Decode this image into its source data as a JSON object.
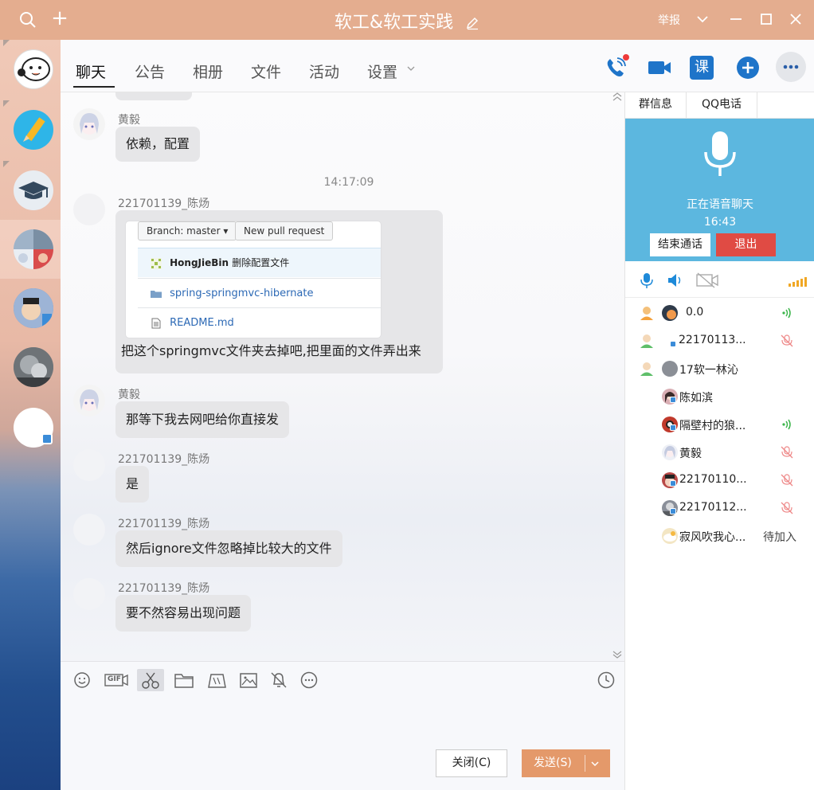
{
  "window": {
    "title": "软工&软工实践",
    "report_label": "举报"
  },
  "tabs": {
    "items": [
      {
        "label": "聊天"
      },
      {
        "label": "公告"
      },
      {
        "label": "相册"
      },
      {
        "label": "文件"
      },
      {
        "label": "活动"
      },
      {
        "label": "设置"
      }
    ],
    "active": "聊天",
    "icons": [
      "phone-call-icon",
      "video-call-icon",
      "class-icon",
      "add-icon",
      "more-icon"
    ],
    "class_label": "课"
  },
  "chat": {
    "messages": [
      {
        "sender": "黄毅",
        "text": "依赖，配置"
      },
      {
        "timestamp": "14:17:09"
      },
      {
        "sender": "221701139_陈炀",
        "text": "把这个springmvc文件夹去掉吧,把里面的文件弄出来",
        "attachment": {
          "branch_button": "Branch: master",
          "pull_request_button": "New pull request",
          "commit_author": "HongJieBin",
          "commit_message": "删除配置文件",
          "folder": "spring-springmvc-hibernate",
          "file": "README.md"
        }
      },
      {
        "sender": "黄毅",
        "text": "那等下我去网吧给你直接发"
      },
      {
        "sender": "221701139_陈炀",
        "text": "是"
      },
      {
        "sender": "221701139_陈炀",
        "text": "然后ignore文件忽略掉比较大的文件"
      },
      {
        "sender": "221701139_陈炀",
        "text": "要不然容易出现问题"
      }
    ]
  },
  "input": {
    "toolbar_icons": [
      "emoji-icon",
      "gif-icon",
      "screenshot-scissors-icon",
      "folder-icon",
      "gift-icon",
      "image-icon",
      "bell-off-icon",
      "more-options-icon",
      "history-clock-icon"
    ],
    "gif_label": "GIF",
    "close_label": "关闭(C)",
    "send_label": "发送(S)"
  },
  "right_panel": {
    "tabs": [
      {
        "label": "群信息"
      },
      {
        "label": "QQ电话"
      }
    ],
    "voice": {
      "status": "正在语音聊天",
      "timer": "16:43",
      "end_call_label": "结束通话",
      "quit_label": "退出"
    },
    "members": [
      {
        "name": "0.0",
        "state": "speaking"
      },
      {
        "name": "22170113...",
        "state": "muted"
      },
      {
        "name": "17软一林沁",
        "state": ""
      },
      {
        "name": "陈如滨",
        "state": ""
      },
      {
        "name": "隔壁村的狼...",
        "state": "speaking"
      },
      {
        "name": "黄毅",
        "state": "muted"
      },
      {
        "name": "22170110...",
        "state": "muted"
      },
      {
        "name": "22170112...",
        "state": "muted"
      },
      {
        "name": "寂风吹我心...",
        "state": "pending",
        "pending_label": "待加入"
      }
    ]
  },
  "colors": {
    "titlebar": "#e4ad8f",
    "send_button": "#e4996a",
    "voice_panel": "#5cb7df",
    "quit_button": "#e04b44",
    "accent_blue": "#1e74c9"
  }
}
